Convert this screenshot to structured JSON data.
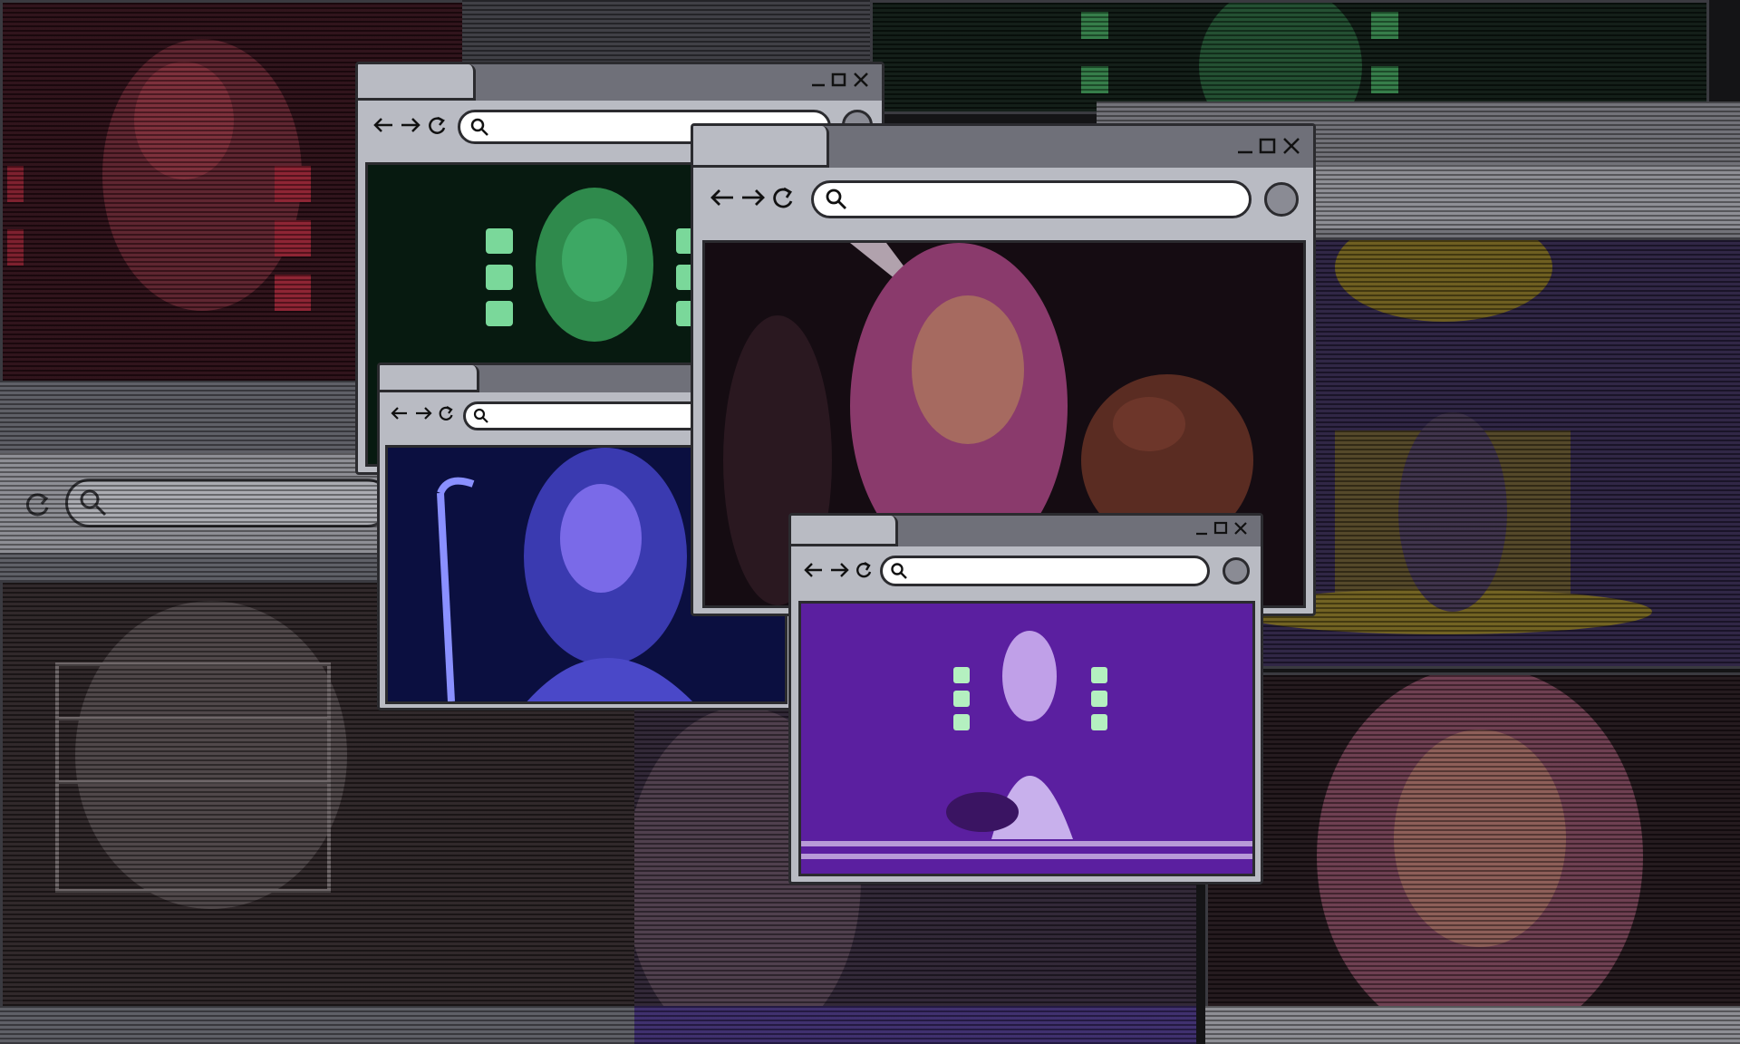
{
  "collage": {
    "background_color": "#141416",
    "frame_color": "#b9bbc3",
    "titlebar_color": "#6f7079",
    "outline_color": "#2b2b2f"
  },
  "icons": {
    "back": "arrow-left-icon",
    "forward": "arrow-right-icon",
    "reload": "reload-icon",
    "search": "search-icon",
    "minimize": "minimize-icon",
    "maximize": "maximize-icon",
    "close": "close-icon"
  },
  "windows": {
    "green": {
      "search_value": "",
      "tint": "#0e4a2a"
    },
    "blue": {
      "search_value": "",
      "tint": "#2a2a9a"
    },
    "pink": {
      "search_value": "",
      "tint": "#3a1626"
    },
    "purple": {
      "search_value": "",
      "tint": "#5a1ea0"
    }
  },
  "background_tiles": {
    "red": "#5a1a24",
    "green": "#12321e",
    "gold": "#6a5a16",
    "mono": "#2c2628",
    "violet": "#3a2856"
  }
}
